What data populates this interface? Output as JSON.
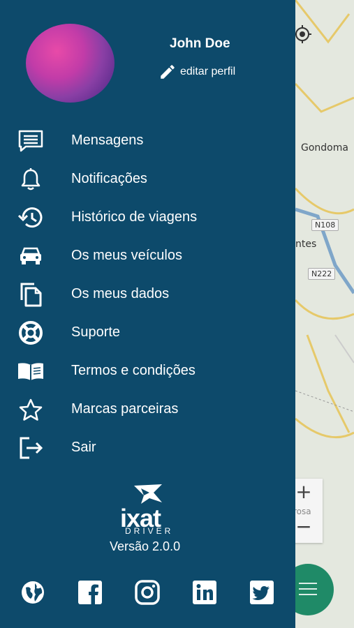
{
  "map": {
    "labels": [
      "Gondoma",
      "ntes"
    ],
    "road_badges": [
      "N108",
      "N222"
    ],
    "zoom_plus": "+",
    "zoom_caption": "rosa",
    "zoom_minus": "−"
  },
  "profile": {
    "name": "John Doe",
    "edit_label": "editar perfil"
  },
  "menu": {
    "items": [
      {
        "label": "Mensagens",
        "icon": "message-icon"
      },
      {
        "label": "Notificações",
        "icon": "bell-icon"
      },
      {
        "label": "Histórico de viagens",
        "icon": "history-icon"
      },
      {
        "label": "Os meus veículos",
        "icon": "car-icon"
      },
      {
        "label": "Os meus dados",
        "icon": "copy-icon"
      },
      {
        "label": "Suporte",
        "icon": "lifebuoy-icon"
      },
      {
        "label": "Termos e condições",
        "icon": "book-icon"
      },
      {
        "label": "Marcas parceiras",
        "icon": "star-icon"
      },
      {
        "label": "Sair",
        "icon": "logout-icon"
      }
    ]
  },
  "brand": {
    "word": "ixat",
    "sub": "DRIVER",
    "version": "Versão 2.0.0"
  },
  "social": [
    "globe-icon",
    "facebook-icon",
    "instagram-icon",
    "linkedin-icon",
    "twitter-icon"
  ],
  "colors": {
    "drawer": "#0d4a6b",
    "fab": "#1f8a67"
  }
}
